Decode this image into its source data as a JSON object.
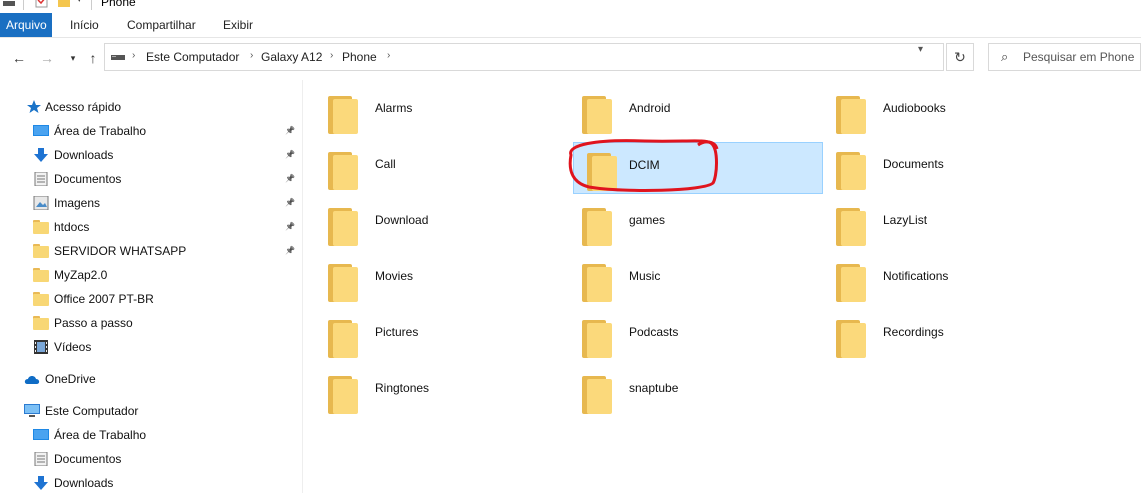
{
  "window": {
    "title": "Phone"
  },
  "ribbon": {
    "tabs": [
      "Arquivo",
      "Início",
      "Compartilhar",
      "Exibir"
    ]
  },
  "address": {
    "crumbs": [
      "Este Computador",
      "Galaxy A12",
      "Phone"
    ],
    "search_placeholder": "Pesquisar em Phone"
  },
  "nav": {
    "quick_access": "Acesso rápido",
    "quick_items": [
      {
        "label": "Área de Trabalho",
        "icon": "desktop-icon",
        "pinned": true
      },
      {
        "label": "Downloads",
        "icon": "download-icon",
        "pinned": true
      },
      {
        "label": "Documentos",
        "icon": "documents-icon",
        "pinned": true
      },
      {
        "label": "Imagens",
        "icon": "pictures-icon",
        "pinned": true
      },
      {
        "label": "htdocs",
        "icon": "folder-icon",
        "pinned": true
      },
      {
        "label": "SERVIDOR WHATSAPP",
        "icon": "folder-icon",
        "pinned": true
      },
      {
        "label": "MyZap2.0",
        "icon": "folder-icon",
        "pinned": false
      },
      {
        "label": "Office 2007 PT-BR",
        "icon": "folder-icon",
        "pinned": false
      },
      {
        "label": "Passo a passo",
        "icon": "folder-icon",
        "pinned": false
      },
      {
        "label": "Vídeos",
        "icon": "videos-icon",
        "pinned": false
      }
    ],
    "onedrive": "OneDrive",
    "this_pc": "Este Computador",
    "pc_items": [
      {
        "label": "Área de Trabalho",
        "icon": "desktop-icon"
      },
      {
        "label": "Documentos",
        "icon": "documents-icon"
      },
      {
        "label": "Downloads",
        "icon": "download-icon"
      }
    ]
  },
  "folders": [
    "Alarms",
    "Android",
    "Audiobooks",
    "Call",
    "DCIM",
    "Documents",
    "Download",
    "games",
    "LazyList",
    "Movies",
    "Music",
    "Notifications",
    "Pictures",
    "Podcasts",
    "Recordings",
    "Ringtones",
    "snaptube"
  ],
  "selected_folder": "DCIM",
  "colors": {
    "accent": "#1a6fc2",
    "selection": "#cce8ff",
    "annotation": "#e0141e",
    "folder": "#f8d775"
  }
}
